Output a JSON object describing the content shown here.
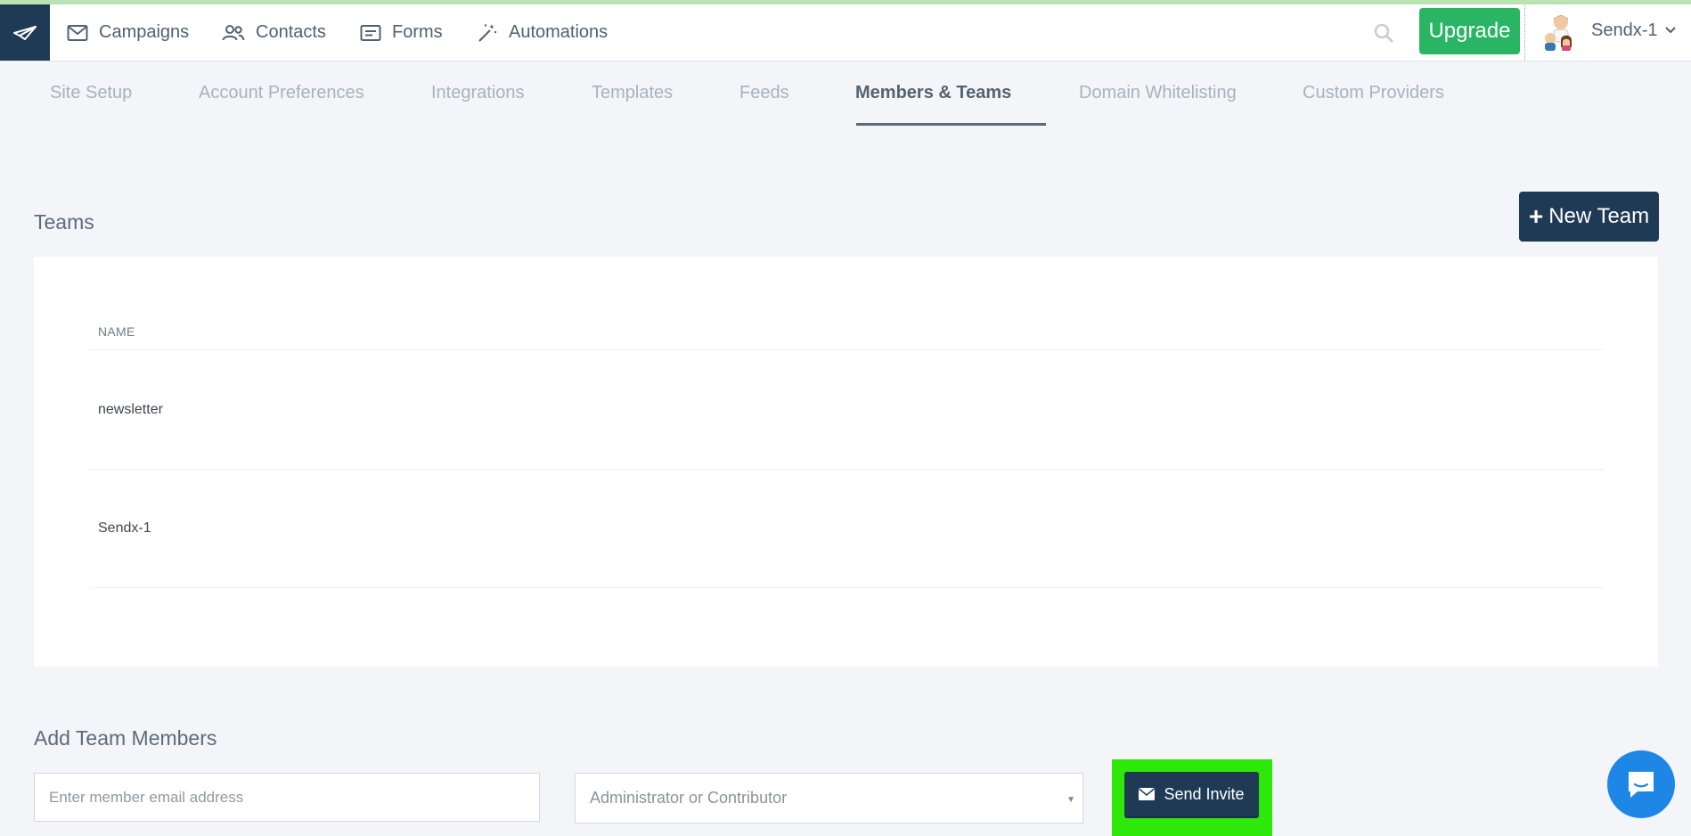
{
  "topnav": {
    "items": [
      {
        "label": "Campaigns",
        "icon": "envelope-icon"
      },
      {
        "label": "Contacts",
        "icon": "users-icon"
      },
      {
        "label": "Forms",
        "icon": "form-icon"
      },
      {
        "label": "Automations",
        "icon": "magic-wand-icon"
      }
    ],
    "upgrade_label": "Upgrade",
    "account_name": "Sendx-1"
  },
  "tabs": [
    {
      "label": "Site Setup",
      "active": false
    },
    {
      "label": "Account Preferences",
      "active": false
    },
    {
      "label": "Integrations",
      "active": false
    },
    {
      "label": "Templates",
      "active": false
    },
    {
      "label": "Feeds",
      "active": false
    },
    {
      "label": "Members & Teams",
      "active": true
    },
    {
      "label": "Domain Whitelisting",
      "active": false
    },
    {
      "label": "Custom Providers",
      "active": false
    }
  ],
  "teams": {
    "title": "Teams",
    "new_team_label": "New Team",
    "column_header": "NAME",
    "rows": [
      {
        "name": "newsletter"
      },
      {
        "name": "Sendx-1"
      }
    ]
  },
  "add_members": {
    "title": "Add Team Members",
    "email_placeholder": "Enter member email address",
    "role_selected": "Administrator or Contributor",
    "send_invite_label": "Send Invite"
  },
  "colors": {
    "brand_dark": "#1f3a55",
    "upgrade_green": "#29b563",
    "highlight_green": "#2ee80a",
    "chat_blue": "#1e87e6"
  }
}
